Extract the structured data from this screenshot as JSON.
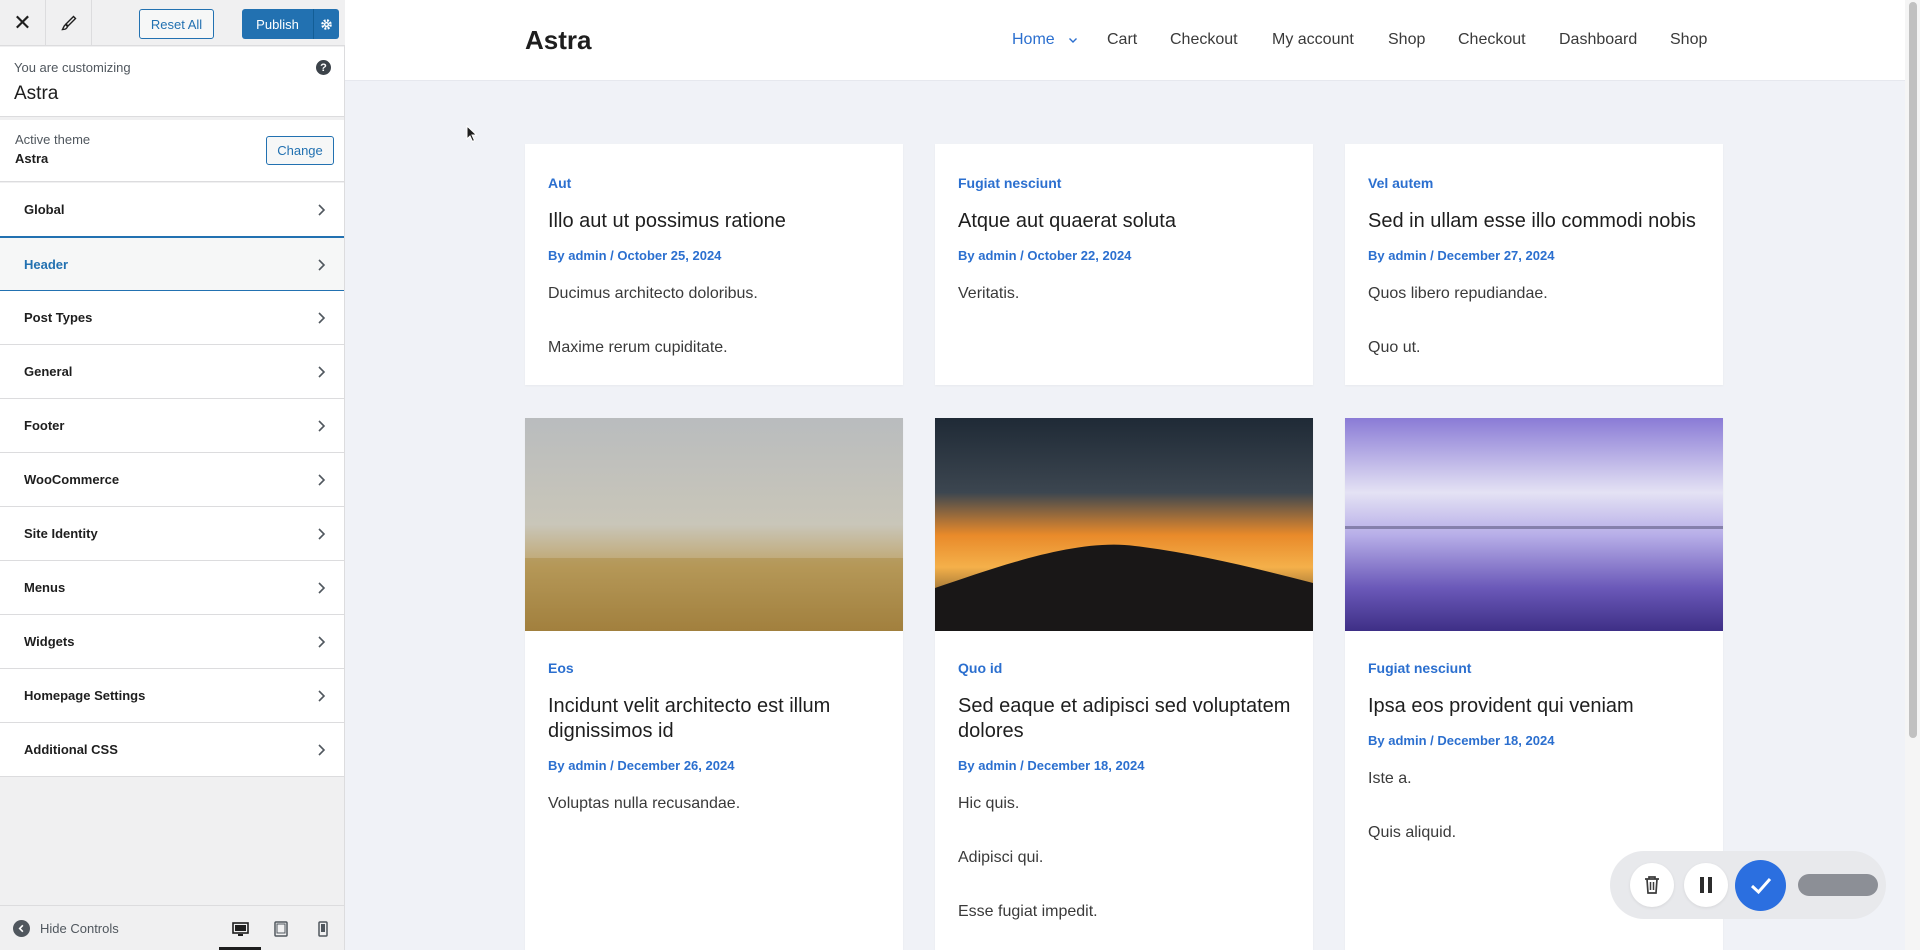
{
  "customizer": {
    "reset_label": "Reset All",
    "publish_label": "Publish",
    "customizing_label": "You are customizing",
    "site_name": "Astra",
    "help_glyph": "?",
    "active_theme_label": "Active theme",
    "active_theme_name": "Astra",
    "change_label": "Change",
    "sections": [
      {
        "label": "Global"
      },
      {
        "label": "Header"
      },
      {
        "label": "Post Types"
      },
      {
        "label": "General"
      },
      {
        "label": "Footer"
      },
      {
        "label": "WooCommerce"
      },
      {
        "label": "Site Identity"
      },
      {
        "label": "Menus"
      },
      {
        "label": "Widgets"
      },
      {
        "label": "Homepage Settings"
      },
      {
        "label": "Additional CSS"
      }
    ],
    "active_section": "Header",
    "hide_controls_label": "Hide Controls",
    "accent_color": "#2271b1"
  },
  "site": {
    "title": "Astra",
    "nav": [
      "Home",
      "Cart",
      "Checkout",
      "My account",
      "Shop",
      "Checkout",
      "Dashboard",
      "Shop"
    ],
    "link_color": "#2b6fcf"
  },
  "posts": [
    {
      "category": "Aut",
      "title": "Illo aut ut possimus ratione",
      "meta": "By admin / October 25, 2024",
      "paragraphs": [
        "Ducimus architecto doloribus.",
        "Maxime rerum cupiditate."
      ]
    },
    {
      "category": "Fugiat nesciunt",
      "title": "Atque aut quaerat soluta",
      "meta": "By admin / October 22, 2024",
      "paragraphs": [
        "Veritatis."
      ]
    },
    {
      "category": "Vel autem",
      "title": "Sed in ullam esse illo commodi nobis",
      "meta": "By admin / December 27, 2024",
      "paragraphs": [
        "Quos libero repudiandae.",
        "Quo ut."
      ]
    },
    {
      "category": "Eos",
      "title": "Incidunt velit architecto est illum dignissimos id",
      "meta": "By admin / December 26, 2024",
      "paragraphs": [
        "Voluptas nulla recusandae."
      ]
    },
    {
      "category": "Quo id",
      "title": "Sed eaque et adipisci sed voluptatem dolores",
      "meta": "By admin / December 18, 2024",
      "paragraphs": [
        "Hic quis.",
        "Adipisci qui.",
        "Esse fugiat impedit."
      ]
    },
    {
      "category": "Fugiat nesciunt",
      "title": "Ipsa eos provident qui veniam",
      "meta": "By admin / December 18, 2024",
      "paragraphs": [
        "Iste a.",
        "Quis aliquid."
      ]
    }
  ],
  "recorder": {
    "icons": [
      "trash-icon",
      "pause-icon",
      "check-icon"
    ]
  }
}
